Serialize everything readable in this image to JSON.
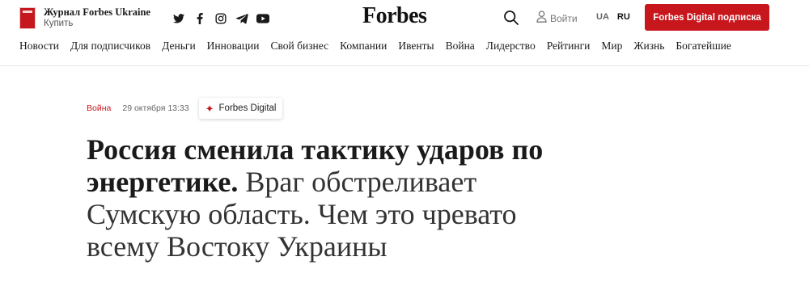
{
  "header": {
    "magazine_title": "Журнал Forbes Ukraine",
    "magazine_buy": "Купить",
    "socials": [
      "twitter-icon",
      "facebook-icon",
      "instagram-icon",
      "telegram-icon",
      "youtube-icon"
    ],
    "logo": "Forbes",
    "login_label": "Войти",
    "lang_ua": "UA",
    "lang_ru": "RU",
    "subscribe_label": "Forbes Digital подписка",
    "brand_color": "#c8161d"
  },
  "nav": {
    "items": [
      "Новости",
      "Для подписчиков",
      "Деньги",
      "Инновации",
      "Свой бизнес",
      "Компании",
      "Ивенты",
      "Война",
      "Лидерство",
      "Рейтинги",
      "Мир",
      "Жизнь",
      "Богатейшие"
    ]
  },
  "article": {
    "category": "Война",
    "date": "29 октября 13:33",
    "badge_label": "Forbes Digital",
    "headline_bold": "Россия сменила тактику ударов по энергетике.",
    "headline_rest": " Враг обстреливает Сумскую область. Чем это чревато всему Востоку Украины"
  }
}
